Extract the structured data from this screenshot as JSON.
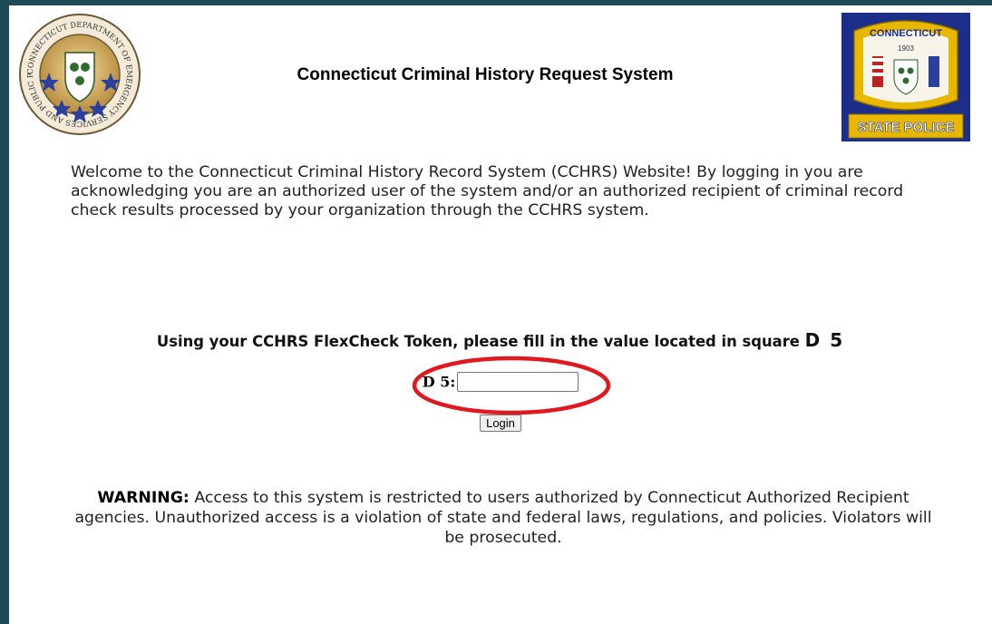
{
  "header": {
    "title": "Connecticut Criminal History Request System",
    "left_seal": {
      "icon": "dept-emergency-services-seal-icon",
      "ring_text": "CONNECTICUT DEPARTMENT OF EMERGENCY SERVICES AND PUBLIC PROTECTION"
    },
    "right_seal": {
      "icon": "state-police-badge-icon",
      "top_text": "CONNECTICUT",
      "year": "1903",
      "bottom_text": "STATE POLICE"
    }
  },
  "welcome_text": "Welcome to the Connecticut Criminal History Record System (CCHRS) Website! By logging in you are acknowledging you are an authorized user of the system and/or an authorized recipient of criminal record check results processed by your organization through the CCHRS system.",
  "token": {
    "instruction": "Using your CCHRS FlexCheck Token, please fill in the value located in square",
    "square": "D 5",
    "field_label": "D 5:",
    "field_value": ""
  },
  "login_button_label": "Login",
  "warning": {
    "label": "WARNING:",
    "text": "Access to this system is restricted to users authorized by Connecticut Authorized Recipient agencies. Unauthorized access is a violation of state and federal laws, regulations, and policies. Violators will be prosecuted."
  },
  "colors": {
    "frame": "#1f4a57",
    "highlight_ellipse": "#e0191e",
    "badge_blue": "#1c2d8a",
    "badge_gold": "#e8b800"
  }
}
